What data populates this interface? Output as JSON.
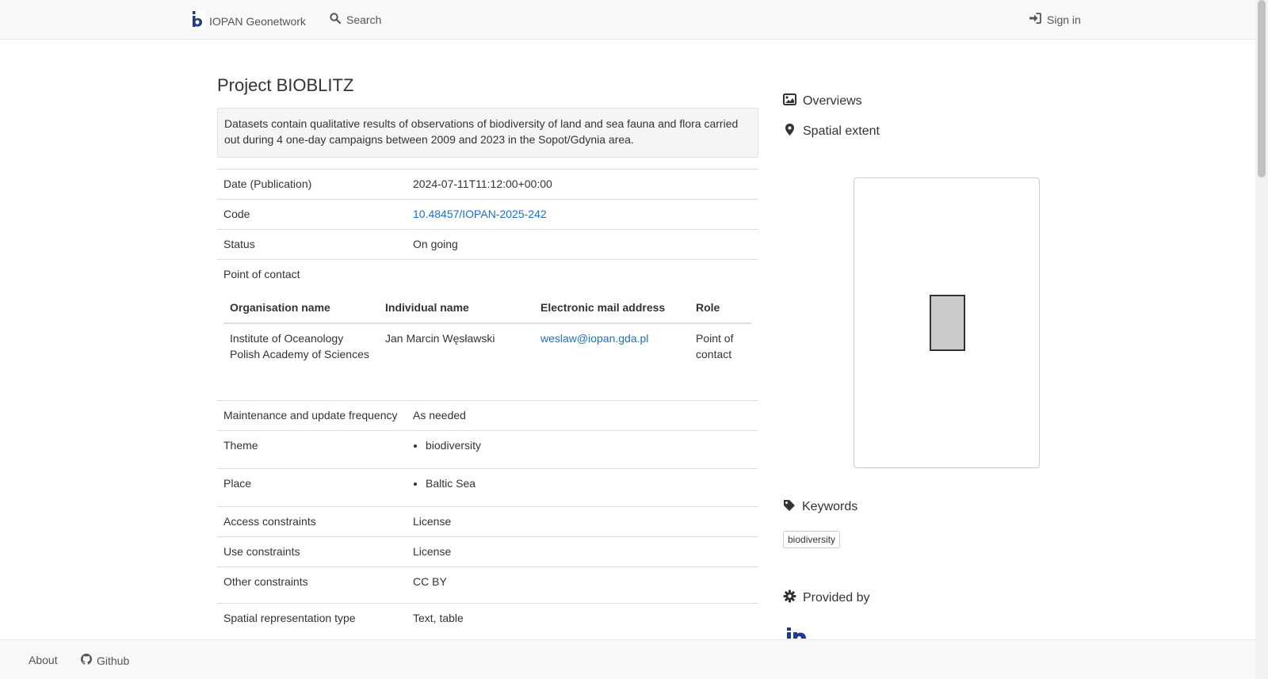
{
  "navbar": {
    "brand_label": "IOPAN Geonetwork",
    "search_label": "Search",
    "signin_label": "Sign in"
  },
  "record": {
    "title": "Project BIOBLITZ",
    "abstract": "Datasets contain qualitative results of observations of biodiversity of land and sea fauna and flora carried out during 4 one-day campaigns between 2009 and 2023 in the Sopot/Gdynia area.",
    "date": {
      "label": "Date (Publication)",
      "value": "2024-07-11T11:12:00+00:00"
    },
    "code": {
      "label": "Code",
      "value": "10.48457/IOPAN-2025-242"
    },
    "status": {
      "label": "Status",
      "value": "On going"
    },
    "contact": {
      "label": "Point of contact",
      "headers": {
        "org": "Organisation name",
        "individual": "Individual name",
        "email": "Electronic mail address",
        "role": "Role"
      },
      "row": {
        "org_line1": "Institute of Oceanology",
        "org_line2": "Polish Academy of Sciences",
        "individual": "Jan Marcin Węsławski",
        "email": "weslaw@iopan.gda.pl",
        "role_line1": "Point of",
        "role_line2": "contact"
      }
    },
    "frequency": {
      "label": "Maintenance and update frequency",
      "value": "As needed"
    },
    "theme": {
      "label": "Theme",
      "items": [
        "biodiversity"
      ]
    },
    "place": {
      "label": "Place",
      "items": [
        "Baltic Sea"
      ]
    },
    "access": {
      "label": "Access constraints",
      "value": "License"
    },
    "use": {
      "label": "Use constraints",
      "value": "License"
    },
    "other": {
      "label": "Other constraints",
      "value": "CC BY"
    },
    "spatial_rep": {
      "label": "Spatial representation type",
      "value": "Text, table"
    }
  },
  "sidebar": {
    "overviews_label": "Overviews",
    "spatial_extent_label": "Spatial extent",
    "keywords_label": "Keywords",
    "keywords": [
      "biodiversity"
    ],
    "provided_by_label": "Provided by"
  },
  "footer": {
    "about_label": "About",
    "github_label": "Github"
  },
  "colors": {
    "link": "#1a6fd1",
    "navbar_bg": "#f8f8f8",
    "abstract_bg": "#f4f5f4",
    "logo_blue": "#1f3a93"
  }
}
